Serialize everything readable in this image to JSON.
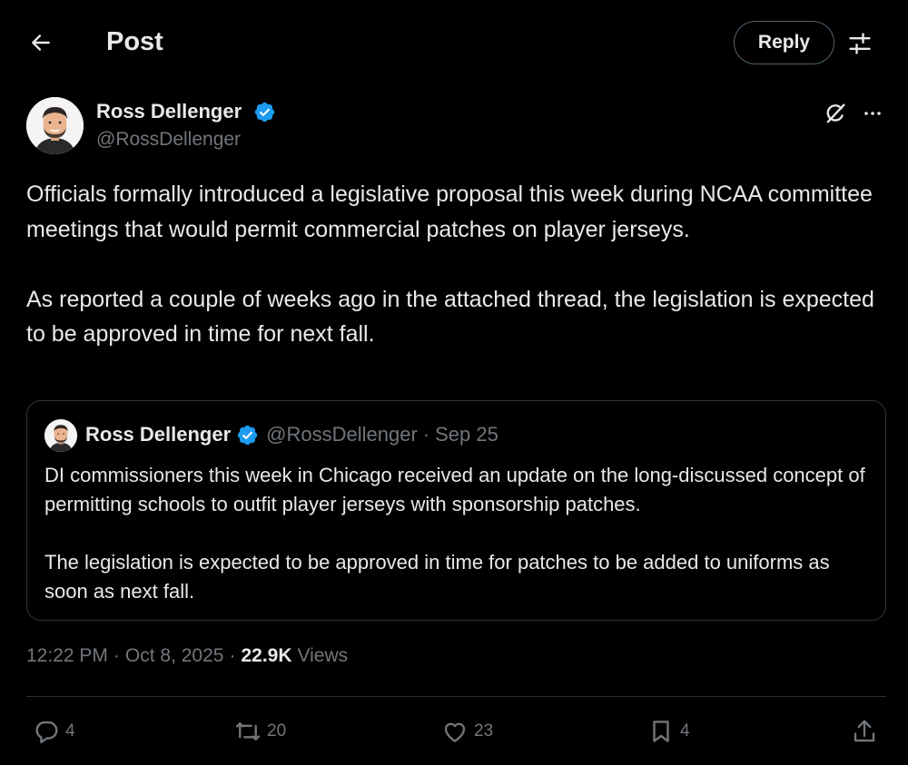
{
  "header": {
    "title": "Post",
    "reply_label": "Reply"
  },
  "post": {
    "author_name": "Ross Dellenger",
    "author_handle": "@RossDellenger",
    "text": "Officials formally introduced a legislative proposal this week during NCAA committee meetings that would permit commercial patches on player jerseys.\n\nAs reported a couple of weeks ago in the attached thread, the legislation is expected to be approved in time for next fall.",
    "time": "12:22 PM",
    "date": "Oct 8, 2025",
    "views_count": "22.9K",
    "views_label": "Views"
  },
  "quote": {
    "author_name": "Ross Dellenger",
    "author_handle": "@RossDellenger",
    "date": "Sep 25",
    "text": "DI commissioners this week in Chicago received an update on the long-discussed concept of permitting schools to outfit player jerseys with sponsorship patches.\n\nThe legislation is expected to be approved in time for patches to be added to uniforms as soon as next fall."
  },
  "actions": {
    "replies": "4",
    "reposts": "20",
    "likes": "23",
    "bookmarks": "4"
  },
  "icons": [
    "back-arrow-icon",
    "settings-sliders-icon",
    "verified-badge-icon",
    "grok-icon",
    "more-dots-icon",
    "reply-icon",
    "repost-icon",
    "like-icon",
    "bookmark-icon",
    "share-icon"
  ],
  "colors": {
    "background": "#000000",
    "text": "#e7e9ea",
    "muted": "#71767b",
    "verified": "#1d9bf0",
    "border": "#2f3336"
  }
}
